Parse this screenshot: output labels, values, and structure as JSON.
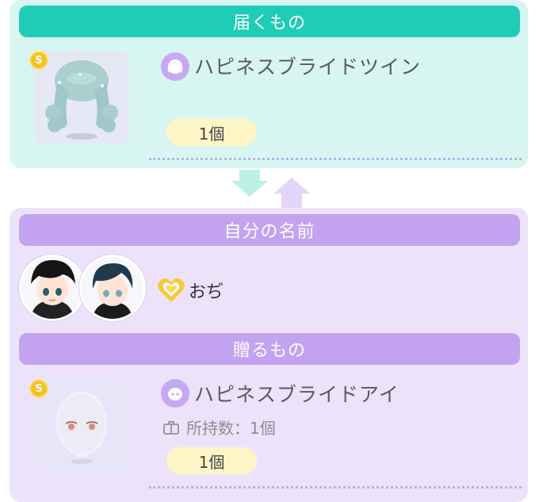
{
  "receive": {
    "header": "届くもの",
    "item_name": "ハピネスブライドツイン",
    "quantity": "1個",
    "coin_symbol": "S",
    "icon": "hair-icon"
  },
  "sender": {
    "header": "自分の名前",
    "name": "おぢ",
    "badge_icon": "heart-badge-icon"
  },
  "gift": {
    "header": "贈るもの",
    "item_name": "ハピネスブライドアイ",
    "owned_text": "所持数：1個",
    "quantity": "1個",
    "coin_symbol": "S",
    "icon": "face-icon"
  },
  "colors": {
    "teal": "#1fcdb7",
    "teal_bg": "#d8f6f1",
    "purple": "#c3a3ef",
    "purple_bg": "#ece3fb",
    "quantity_bg": "#fdf5c6",
    "coin": "#f3c326"
  }
}
